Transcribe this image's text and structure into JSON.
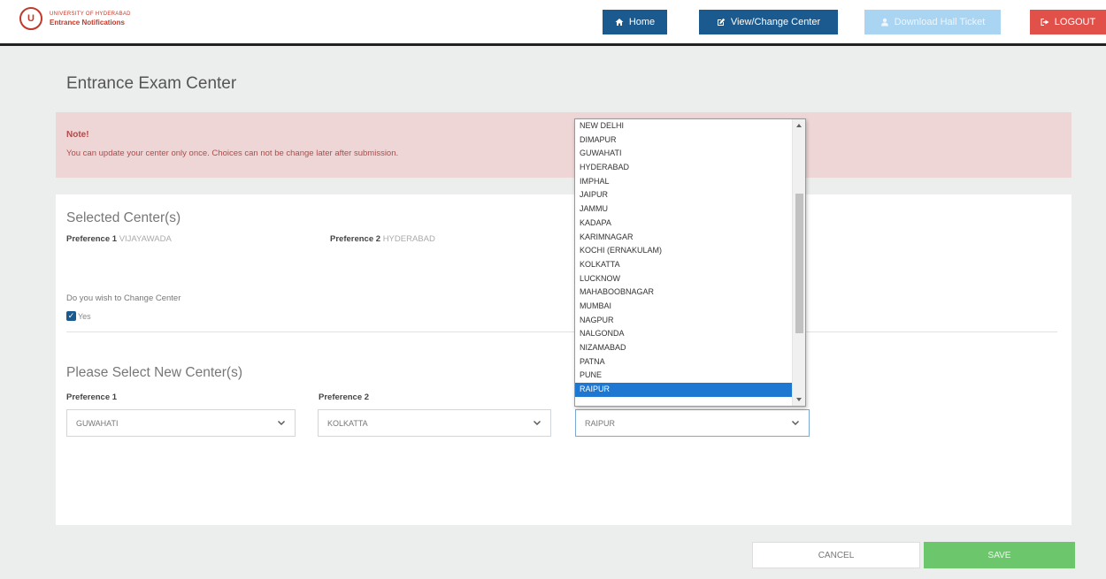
{
  "header": {
    "logo_line1": "UNIVERSITY OF HYDERABAD",
    "logo_line2": "Entrance Notifications",
    "nav": [
      {
        "label": "Home",
        "icon": "home-icon"
      },
      {
        "label": "View/Change Center",
        "icon": "edit-icon"
      },
      {
        "label": "Download Hall Ticket",
        "icon": "user-icon"
      },
      {
        "label": "LOGOUT",
        "icon": "logout-icon"
      }
    ]
  },
  "page": {
    "title": "Entrance Exam Center"
  },
  "note": {
    "title": "Note!",
    "text": "You can update your center only once. Choices can not be change later after submission."
  },
  "selected": {
    "heading": "Selected Center(s)",
    "pref1_label": "Preference 1",
    "pref1_value": "VIJAYAWADA",
    "pref2_label": "Preference 2",
    "pref2_value": "HYDERABAD"
  },
  "change": {
    "question": "Do you wish to Change Center",
    "yes_label": "Yes",
    "checked": true
  },
  "new_center": {
    "heading": "Please Select New Center(s)",
    "pref1_label": "Preference 1",
    "pref1_value": "GUWAHATI",
    "pref2_label": "Preference 2",
    "pref2_value": "KOLKATTA",
    "pref3_value": "RAIPUR"
  },
  "dropdown": {
    "options": [
      "NEW DELHI",
      "DIMAPUR",
      "GUWAHATI",
      "HYDERABAD",
      "IMPHAL",
      "JAIPUR",
      "JAMMU",
      "KADAPA",
      "KARIMNAGAR",
      "KOCHI (ERNAKULAM)",
      "KOLKATTA",
      "LUCKNOW",
      "MAHABOOBNAGAR",
      "MUMBAI",
      "NAGPUR",
      "NALGONDA",
      "NIZAMABAD",
      "PATNA",
      "PUNE",
      "RAIPUR"
    ],
    "selected": "RAIPUR"
  },
  "actions": {
    "cancel": "CANCEL",
    "save": "SAVE"
  },
  "colors": {
    "primary": "#1b5a8e",
    "logout": "#e2504a",
    "note_bg": "#efd6d6",
    "save": "#6cc76c",
    "selected_option": "#1e78d2"
  }
}
